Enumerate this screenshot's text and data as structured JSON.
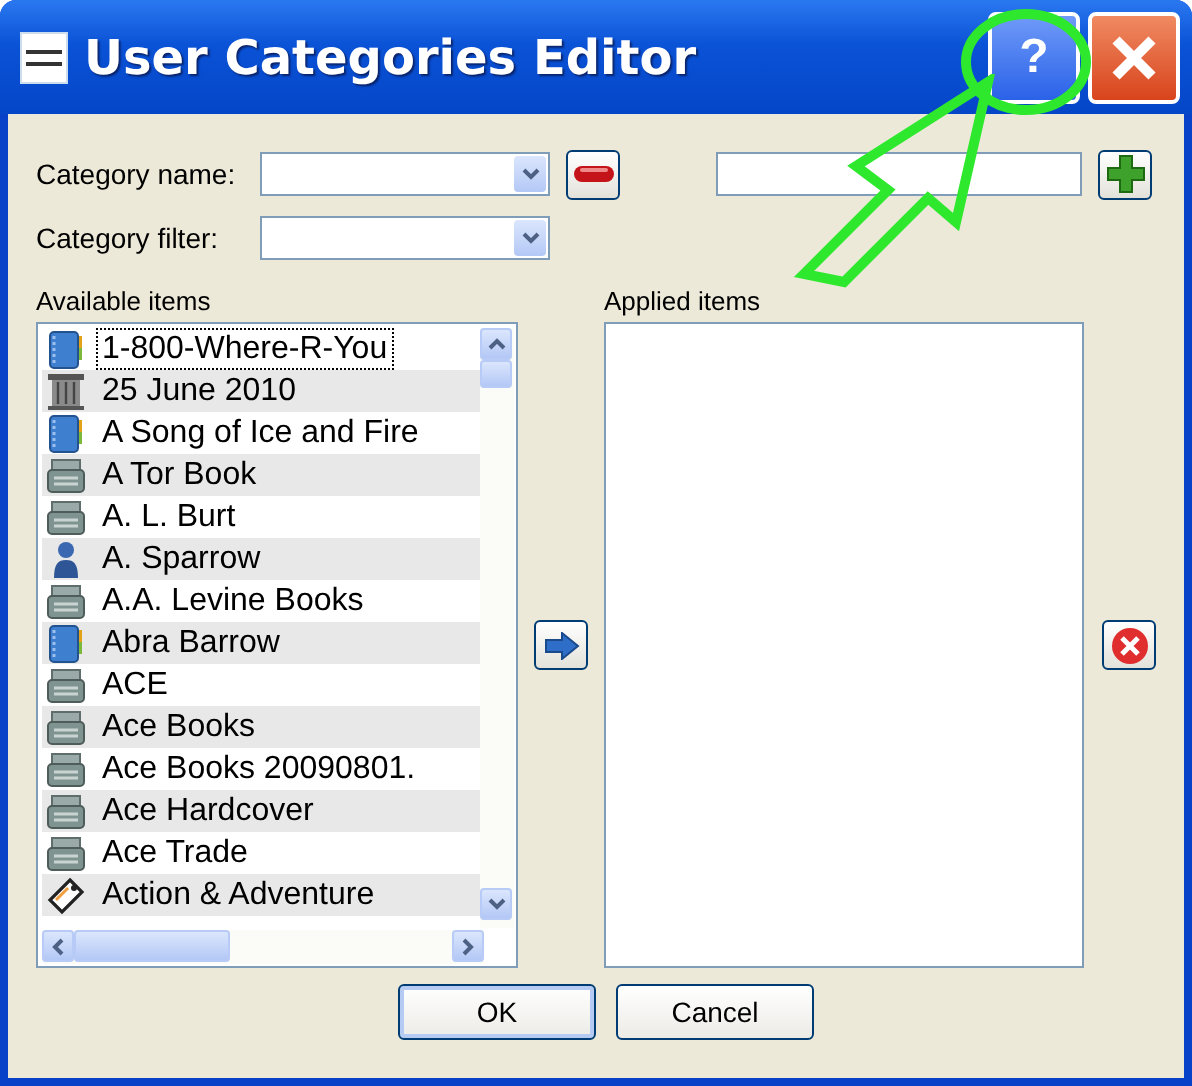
{
  "window": {
    "title": "User Categories Editor",
    "help_button": "?"
  },
  "category_name": {
    "label": "Category name:"
  },
  "category_filter": {
    "label": "Category filter:"
  },
  "available_items": {
    "label": "Available items",
    "items": [
      {
        "text": "1-800-Where-R-You",
        "kind": "series",
        "focused": true
      },
      {
        "text": "25 June 2010",
        "kind": "date",
        "focused": false
      },
      {
        "text": "A Song of Ice and Fire",
        "kind": "series",
        "focused": false
      },
      {
        "text": "A Tor Book",
        "kind": "publisher",
        "focused": false
      },
      {
        "text": "A. L. Burt",
        "kind": "publisher",
        "focused": false
      },
      {
        "text": "A. Sparrow",
        "kind": "author",
        "focused": false
      },
      {
        "text": "A.A. Levine Books",
        "kind": "publisher",
        "focused": false
      },
      {
        "text": "Abra Barrow",
        "kind": "series",
        "focused": false
      },
      {
        "text": "ACE",
        "kind": "publisher",
        "focused": false
      },
      {
        "text": "Ace Books",
        "kind": "publisher",
        "focused": false
      },
      {
        "text": "Ace Books 20090801.",
        "kind": "publisher",
        "focused": false
      },
      {
        "text": "Ace Hardcover",
        "kind": "publisher",
        "focused": false
      },
      {
        "text": "Ace Trade",
        "kind": "publisher",
        "focused": false
      },
      {
        "text": "Action & Adventure",
        "kind": "tag",
        "focused": false
      }
    ]
  },
  "applied_items": {
    "label": "Applied items"
  },
  "buttons": [
    {
      "label": "OK",
      "default": true
    },
    {
      "label": "Cancel",
      "default": false
    }
  ]
}
